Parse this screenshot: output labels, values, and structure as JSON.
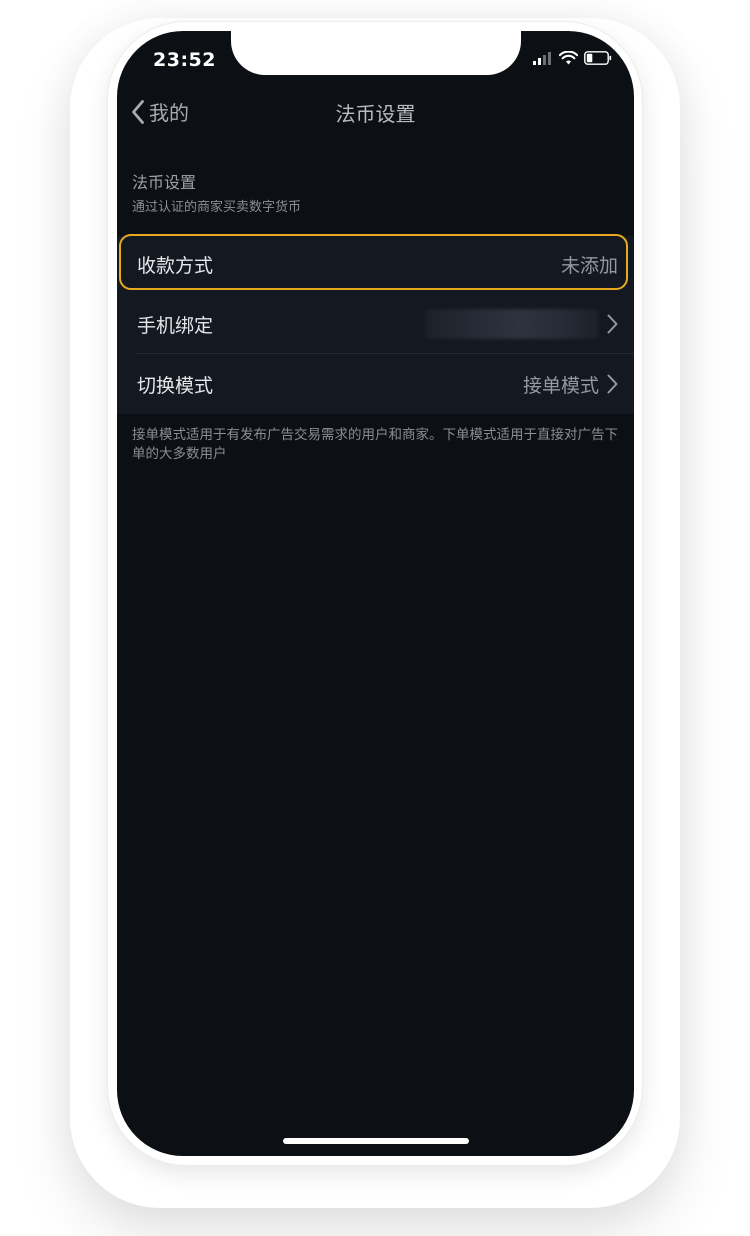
{
  "status_bar": {
    "time": "23:52"
  },
  "nav": {
    "back_label": "我的",
    "title": "法币设置"
  },
  "section": {
    "title": "法币设置",
    "subtitle": "通过认证的商家买卖数字货币"
  },
  "rows": [
    {
      "label": "收款方式",
      "value": "未添加",
      "highlighted": true
    },
    {
      "label": "手机绑定",
      "value": ""
    },
    {
      "label": "切换模式",
      "value": "接单模式"
    }
  ],
  "note": "接单模式适用于有发布广告交易需求的用户和商家。下单模式适用于直接对广告下单的大多数用户",
  "colors": {
    "background": "#0c0f13",
    "row_bg": "#141820",
    "highlight": "#e7a91f"
  }
}
